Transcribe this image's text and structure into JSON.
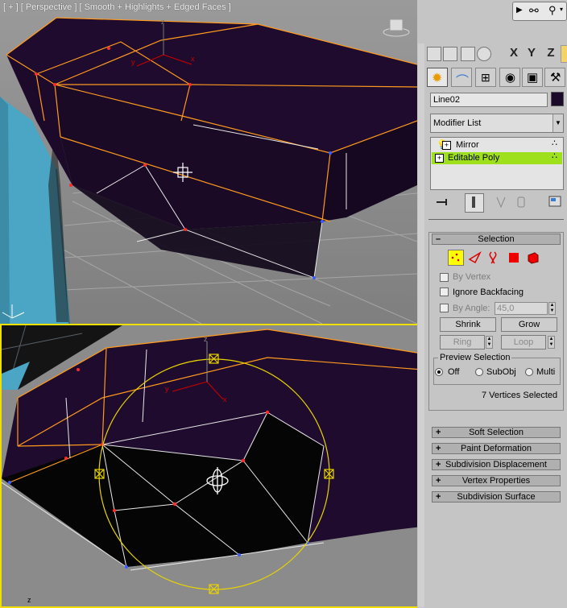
{
  "viewport_top": {
    "label": "[ + ] [ Perspective ] [ Smooth + Highlights + Edged Faces ]"
  },
  "viewport_bottom": {
    "axis_label": "z"
  },
  "toolbar": {
    "axis_x": "X",
    "axis_y": "Y",
    "axis_z": "Z"
  },
  "command_panel": {
    "object_name": "Line02",
    "object_color": "#1c0a2a",
    "modifier_list": "Modifier List",
    "stack": [
      {
        "label": "Mirror",
        "selected": false
      },
      {
        "label": "Editable Poly",
        "selected": true
      }
    ],
    "selection": {
      "title": "Selection",
      "by_vertex": "By Vertex",
      "ignore_backfacing": "Ignore Backfacing",
      "by_angle": "By Angle:",
      "angle_value": "45,0",
      "shrink": "Shrink",
      "grow": "Grow",
      "ring": "Ring",
      "loop": "Loop",
      "preview_title": "Preview Selection",
      "preview_off": "Off",
      "preview_subobj": "SubObj",
      "preview_multi": "Multi",
      "status": "7 Vertices Selected"
    },
    "rollouts": [
      "Soft Selection",
      "Paint Deformation",
      "Subdivision Displacement",
      "Vertex Properties",
      "Subdivision Surface"
    ]
  },
  "colors": {
    "mesh_fill": "#1e0b2d",
    "edge_highlight": "#ff9a1f",
    "gizmo": "#e8d400",
    "active_stack": "#9ee01c"
  }
}
